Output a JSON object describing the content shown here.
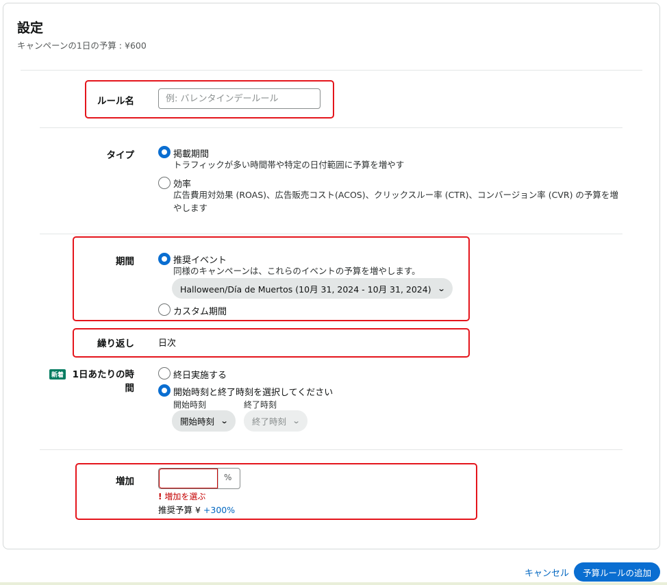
{
  "header": {
    "title": "設定",
    "subtitle": "キャンペーンの1日の予算 : ¥600"
  },
  "rule_name": {
    "label": "ルール名",
    "placeholder": "例: バレンタインデールール",
    "value": ""
  },
  "type": {
    "label": "タイプ",
    "options": [
      {
        "label": "掲載期間",
        "description": "トラフィックが多い時間帯や特定の日付範囲に予算を増やす",
        "checked": true
      },
      {
        "label": "効率",
        "description": "広告費用対効果 (ROAS)、広告販売コスト(ACOS)、クリックスルー率 (CTR)、コンバージョン率 (CVR) の予算を増やします",
        "checked": false
      }
    ]
  },
  "period": {
    "label": "期間",
    "options": [
      {
        "label": "推奨イベント",
        "description": "同様のキャンペーンは、これらのイベントの予算を増やします。",
        "checked": true
      },
      {
        "label": "カスタム期間",
        "checked": false
      }
    ],
    "event_select": "Halloween/Día de Muertos (10月 31, 2024 - 10月 31, 2024)"
  },
  "repeat": {
    "label": "繰り返し",
    "value": "日次"
  },
  "daily_time": {
    "badge": "新着",
    "label": "1日あたりの時間",
    "options": [
      {
        "label": "終日実施する",
        "checked": false
      },
      {
        "label": "開始時刻と終了時刻を選択してください",
        "checked": true
      }
    ],
    "start_label": "開始時刻",
    "end_label": "終了時刻",
    "start_select": "開始時刻",
    "end_select": "終了時刻"
  },
  "increase": {
    "label": "増加",
    "value": "",
    "unit": "%",
    "error_icon": "!",
    "error": "増加を選ぶ",
    "recommend_label": "推奨予算 ¥",
    "recommend_value": "+300%"
  },
  "footer": {
    "cancel": "キャンセル",
    "add": "予算ルールの追加"
  },
  "colors": {
    "accent": "#0a6ed1",
    "error": "#c40000",
    "highlight_box": "#e4141b",
    "badge": "#067d62"
  }
}
